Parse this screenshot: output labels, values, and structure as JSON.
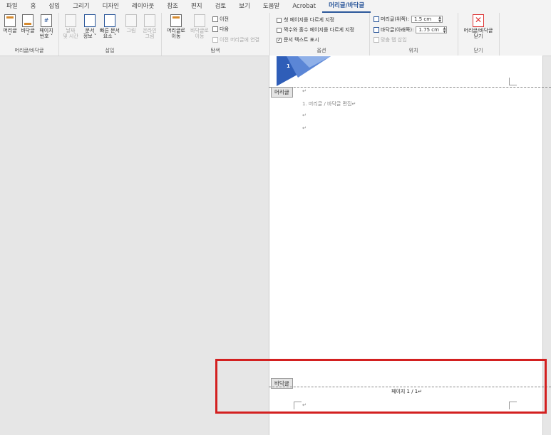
{
  "tabs": [
    "파일",
    "홈",
    "삽입",
    "그리기",
    "디자인",
    "레이아웃",
    "참조",
    "편지",
    "검토",
    "보기",
    "도움말",
    "Acrobat",
    "머리글/바닥글"
  ],
  "active_tab": "머리글/바닥글",
  "groups": {
    "header_footer": {
      "label": "머리글/바닥글",
      "buttons": [
        {
          "label1": "머리글",
          "label2": "˅"
        },
        {
          "label1": "바닥글",
          "label2": "˅"
        },
        {
          "label1": "페이지",
          "label2": "번호 ˅"
        }
      ]
    },
    "insert": {
      "label": "삽입",
      "buttons": [
        {
          "label1": "날짜",
          "label2": "및 시간"
        },
        {
          "label1": "문서",
          "label2": "정보 ˅"
        },
        {
          "label1": "빠른 문서",
          "label2": "요소 ˅"
        },
        {
          "label1": "그림",
          "label2": ""
        },
        {
          "label1": "온라인",
          "label2": "그림"
        }
      ]
    },
    "navigation": {
      "label": "탐색",
      "buttons": [
        {
          "label1": "머리글로",
          "label2": "이동"
        },
        {
          "label1": "바닥글로",
          "label2": "이동"
        }
      ],
      "prev": "이전",
      "next": "다음",
      "link_previous": "이전 머리글에 연결"
    },
    "options": {
      "label": "옵션",
      "different_first": "첫 페이지를 다르게 지정",
      "different_odd_even": "짝수와 홀수 페이지를 다르게 지정",
      "show_doc_text": "문서 텍스트 표시",
      "different_first_checked": false,
      "different_odd_even_checked": false,
      "show_doc_text_checked": true
    },
    "position": {
      "label": "위치",
      "header_top_label": "머리글(위쪽):",
      "header_top_value": "1.5 cm",
      "footer_bottom_label": "바닥글(아래쪽):",
      "footer_bottom_value": "1.75 cm",
      "insert_align_tab": "맞춤 탭 삽입"
    },
    "close": {
      "label": "닫기",
      "button_label1": "머리글/바닥글",
      "button_label2": "닫기"
    }
  },
  "document": {
    "header_tag": "머리글",
    "footer_tag": "바닥글",
    "banner_number": "1",
    "para_mark": "↵",
    "list_item": "1. 머리글 / 바닥글 편집↵",
    "footer_text": "페이지 1 / 1↵"
  },
  "colors": {
    "accent": "#2b579a",
    "highlight_box": "#d32020",
    "banner_dark": "#2f5eb8",
    "banner_light": "#8fb0e8"
  }
}
